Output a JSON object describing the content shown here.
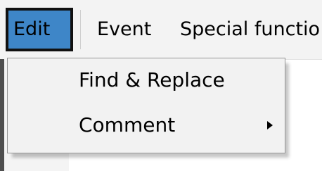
{
  "menubar": {
    "items": [
      {
        "label": "Edit",
        "active": true
      },
      {
        "label": "Event",
        "active": false
      },
      {
        "label": "Special functio",
        "active": false
      }
    ]
  },
  "dropdown": {
    "items": [
      {
        "label": "Find & Replace",
        "has_submenu": false
      },
      {
        "label": "Comment",
        "has_submenu": true,
        "icon": "chevron-right-icon"
      }
    ]
  },
  "colors": {
    "active_menu_bg": "#3e86c8",
    "active_menu_border": "#111111",
    "menu_bg": "#f2f2f2"
  }
}
